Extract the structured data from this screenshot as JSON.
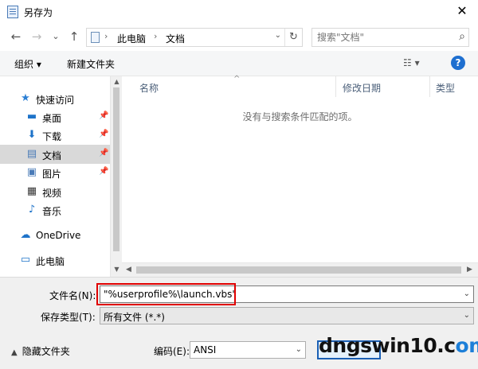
{
  "window": {
    "title": "另存为",
    "close": "✕"
  },
  "nav": {
    "back": "←",
    "forward": "→",
    "recent": "⌄",
    "up": "↑",
    "breadcrumb": [
      "此电脑",
      "文档"
    ],
    "breadcrumb_sep": "›",
    "dropdown": "⌄",
    "refresh": "↻",
    "search_placeholder": "搜索\"文档\"",
    "search_icon": "⌕"
  },
  "toolbar": {
    "organize": "组织 ▾",
    "new_folder": "新建文件夹",
    "view": "☷ ▾",
    "help": "?"
  },
  "sidebar": {
    "items": [
      {
        "label": "快速访问",
        "icon": "★",
        "icon_color": "#2b7fd4",
        "pin": ""
      },
      {
        "label": "桌面",
        "icon": "▬",
        "icon_color": "#1e73c9",
        "pin": "📌"
      },
      {
        "label": "下载",
        "icon": "⬇",
        "icon_color": "#1e73c9",
        "pin": "📌"
      },
      {
        "label": "文档",
        "icon": "▤",
        "icon_color": "#4a7bb7",
        "pin": "📌"
      },
      {
        "label": "图片",
        "icon": "▣",
        "icon_color": "#4a7bb7",
        "pin": "📌"
      },
      {
        "label": "视频",
        "icon": "▦",
        "icon_color": "#333333",
        "pin": ""
      },
      {
        "label": "音乐",
        "icon": "♪",
        "icon_color": "#1e73c9",
        "pin": ""
      },
      {
        "label": "OneDrive",
        "icon": "☁",
        "icon_color": "#1e73c9",
        "pin": ""
      },
      {
        "label": "此电脑",
        "icon": "▭",
        "icon_color": "#1e73c9",
        "pin": ""
      }
    ],
    "scroll_up": "▲",
    "scroll_down": "▼"
  },
  "filelist": {
    "columns": [
      "名称",
      "修改日期",
      "类型"
    ],
    "sort_arrow": "^",
    "empty_message": "没有与搜索条件匹配的项。",
    "scroll_left": "◀",
    "scroll_right": "▶"
  },
  "form": {
    "filename_label": "文件名(N):",
    "filename_value": "\"%userprofile%\\launch.vbs\"",
    "type_label": "保存类型(T):",
    "type_value": "所有文件  (*.*)",
    "dropdown": "⌄",
    "hide_folders": "隐藏文件夹",
    "hide_chevron": "▲",
    "encoding_label": "编码(E):",
    "encoding_value": "ANSI"
  },
  "watermark": {
    "part1": "dngswin10.c",
    "part2": "om"
  },
  "colors": {
    "accent": "#1e6fd0",
    "highlight": "#e00000",
    "selected": "#d9d9d9"
  }
}
